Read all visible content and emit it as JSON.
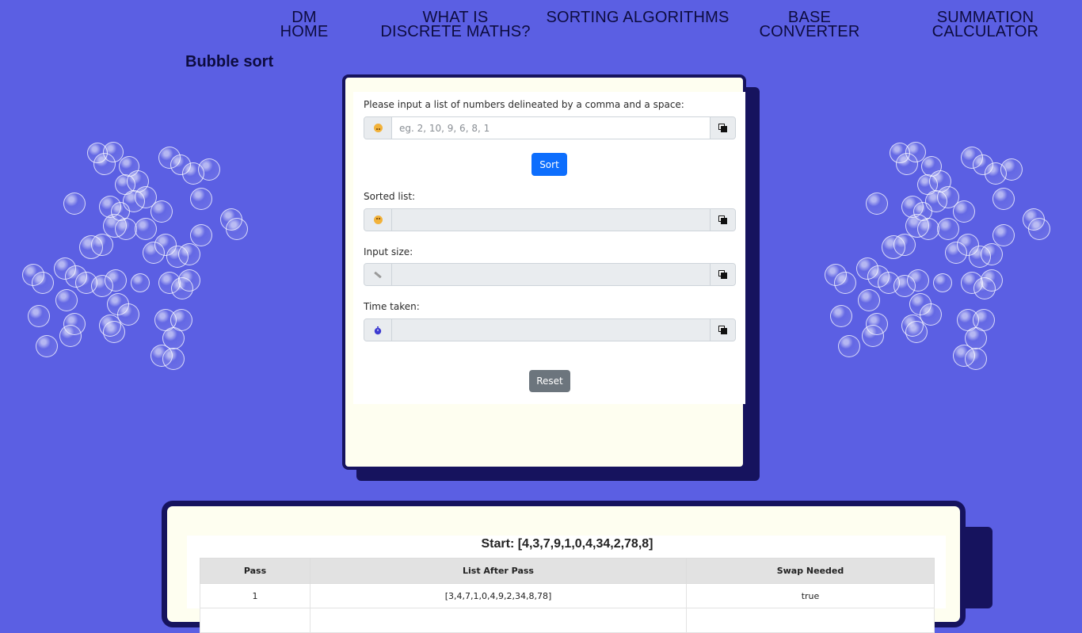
{
  "nav": [
    {
      "lines": [
        "DM",
        "HOME"
      ]
    },
    {
      "lines": [
        "WHAT IS",
        "DISCRETE MATHS?"
      ]
    },
    {
      "lines": [
        "SORTING ALGORITHMS"
      ]
    },
    {
      "lines": [
        "BASE",
        "CONVERTER"
      ]
    },
    {
      "lines": [
        "SUMMATION",
        "CALCULATOR"
      ]
    }
  ],
  "page_title": "Bubble sort",
  "form": {
    "input_label": "Please input a list of numbers delineated by a comma and a space:",
    "input_placeholder": "eg. 2, 10, 9, 6, 8, 1",
    "input_value": "",
    "sort_label": "Sort",
    "sorted_label": "Sorted list:",
    "sorted_value": "",
    "size_label": "Input size:",
    "size_value": "",
    "time_label": "Time taken:",
    "time_value": "",
    "reset_label": "Reset",
    "icons": [
      "upside-down-face-icon",
      "neutral-face-icon",
      "ruler-icon",
      "stopwatch-icon",
      "copy-icon"
    ]
  },
  "results": {
    "title": "Start: [4,3,7,9,1,0,4,34,2,78,8]",
    "columns": [
      "Pass",
      "List After Pass",
      "Swap Needed"
    ],
    "rows": [
      {
        "pass": "1",
        "list": "[3,4,7,1,0,4,9,2,34,8,78]",
        "swap": "true"
      }
    ]
  },
  "colors": {
    "background": "#5b5fe3",
    "card_border": "#16135e",
    "card_fill": "#fefef0",
    "primary_button": "#0d6efd",
    "secondary_button": "#6c757d"
  }
}
